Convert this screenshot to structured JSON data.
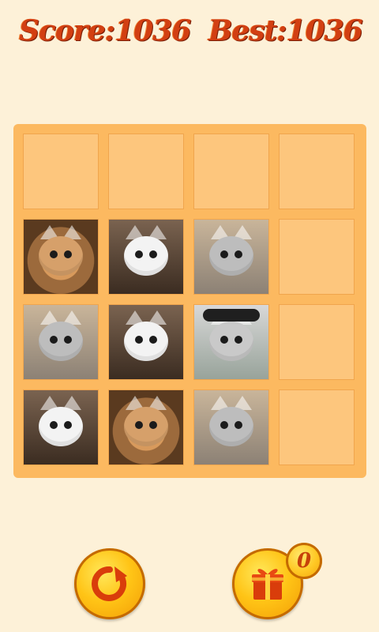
{
  "scoreboard": {
    "score_text": "Score:1036",
    "best_text": "Best:1036"
  },
  "board": {
    "rows": 4,
    "cols": 4,
    "tiles": [
      [
        "empty",
        "empty",
        "empty",
        "empty"
      ],
      [
        "kitten-orange",
        "kitten-white",
        "kitten-grey",
        "empty"
      ],
      [
        "kitten-grey",
        "kitten-white",
        "kitten-pirate",
        "empty"
      ],
      [
        "kitten-white",
        "kitten-orange",
        "kitten-grey",
        "empty"
      ]
    ]
  },
  "controls": {
    "refresh_icon": "refresh-icon",
    "gift_icon": "gift-icon",
    "gift_count": "0"
  },
  "colors": {
    "background": "#fdf1d8",
    "board": "#fcb960",
    "cell": "#fdc67d",
    "score_text": "#d23f12"
  }
}
